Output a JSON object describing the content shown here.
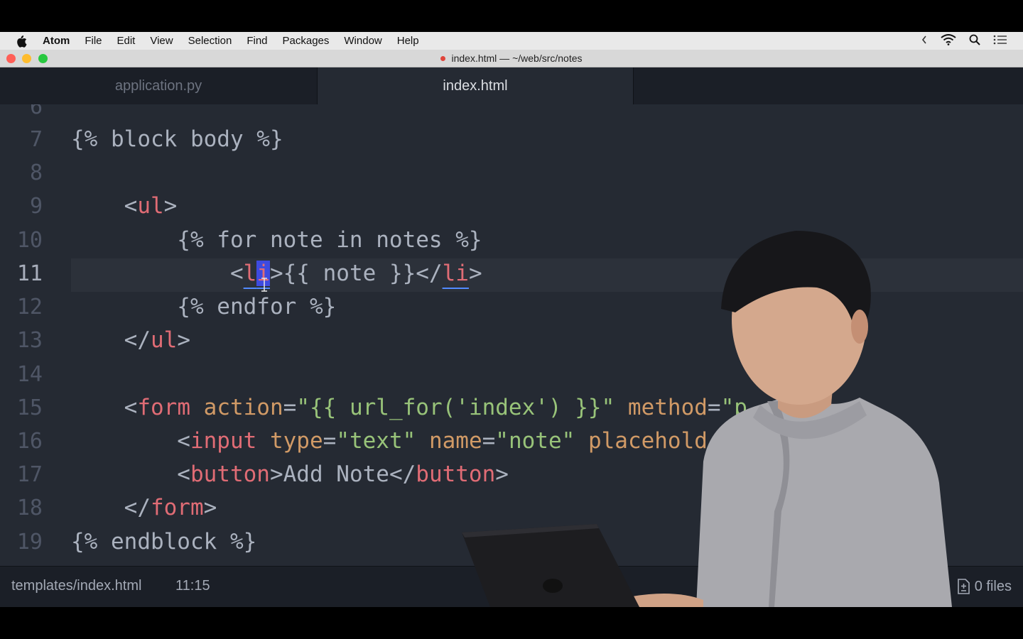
{
  "menubar": {
    "items": [
      "Atom",
      "File",
      "Edit",
      "View",
      "Selection",
      "Find",
      "Packages",
      "Window",
      "Help"
    ]
  },
  "window": {
    "title": "index.html — ~/web/src/notes"
  },
  "tabs": [
    {
      "label": "application.py",
      "active": false
    },
    {
      "label": "index.html",
      "active": true
    }
  ],
  "editor": {
    "line_numbers": [
      "6",
      "7",
      "8",
      "9",
      "10",
      "11",
      "12",
      "13",
      "14",
      "15",
      "16",
      "17",
      "18",
      "19"
    ],
    "current_line": "11"
  },
  "statusbar": {
    "file_path": "templates/index.html",
    "cursor_position": "11:15",
    "files_count": "0 files"
  },
  "colors": {
    "editor_bg": "#252a33",
    "tag": "#e06c75",
    "attribute": "#d19a66",
    "string": "#98c379",
    "text": "#abb2bf",
    "selection": "#3e4be0"
  }
}
